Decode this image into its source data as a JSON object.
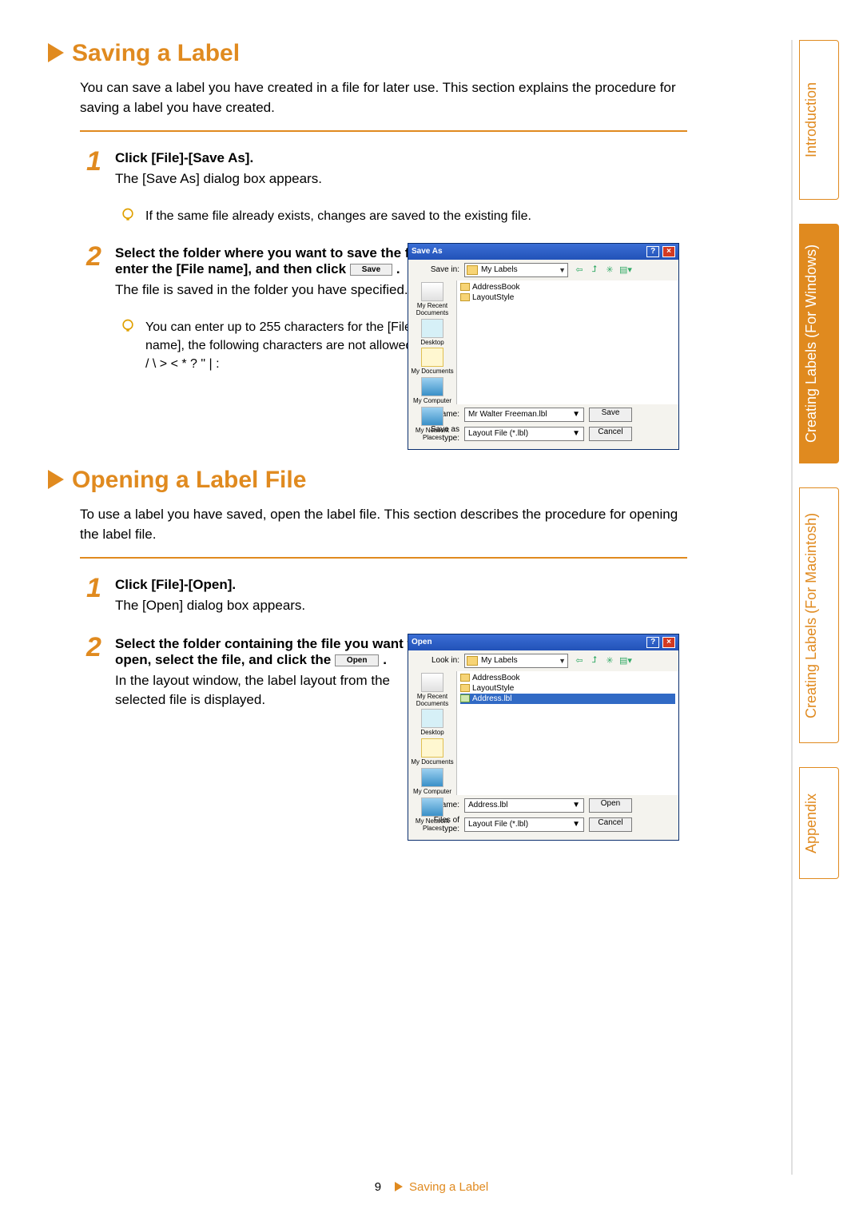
{
  "headings": {
    "saving": "Saving a Label",
    "opening": "Opening a Label File"
  },
  "intro": {
    "saving": "You can save a label you have created in a file for later use. This section explains the procedure for saving a label you have created.",
    "opening": "To use a label you have saved, open the label file. This section describes the procedure for opening the label file."
  },
  "steps_saving": {
    "s1_bold": "Click [File]-[Save As].",
    "s1_plain": "The [Save As] dialog box appears.",
    "s1_tip": "If the same file already exists, changes are saved to the existing file.",
    "s2_bold": "Select the folder where you want to save the file, enter the [File name], and then click ",
    "s2_btn": "Save",
    "s2_plain": "The file is saved in the folder you have specified.",
    "s2_tip_a": "You can enter up to 255 characters for the [File name], the following characters are not allowed:",
    "s2_tip_b": "/ \\ > < * ? \" | :"
  },
  "steps_opening": {
    "s1_bold": "Click [File]-[Open].",
    "s1_plain": "The [Open] dialog box appears.",
    "s2_bold": "Select the folder containing the file you want to open, select the file, and click the ",
    "s2_btn": "Open",
    "s2_plain": "In the layout window, the label layout from the selected file is displayed."
  },
  "dialogs": {
    "save": {
      "title": "Save As",
      "save_in_label": "Save in:",
      "folder": "My Labels",
      "items": [
        "AddressBook",
        "LayoutStyle"
      ],
      "file_name_label": "File name:",
      "file_name_value": "Mr Walter Freeman.lbl",
      "type_label": "Save as type:",
      "type_value": "Layout File (*.lbl)",
      "btn_primary": "Save",
      "btn_cancel": "Cancel"
    },
    "open": {
      "title": "Open",
      "look_in_label": "Look in:",
      "folder": "My Labels",
      "items": [
        "AddressBook",
        "LayoutStyle",
        "Address.lbl"
      ],
      "file_name_label": "File name:",
      "file_name_value": "Address.lbl",
      "type_label": "Files of type:",
      "type_value": "Layout File (*.lbl)",
      "btn_primary": "Open",
      "btn_cancel": "Cancel"
    },
    "places": {
      "recent": "My Recent Documents",
      "desktop": "Desktop",
      "docs": "My Documents",
      "computer": "My Computer",
      "network": "My Network Places"
    }
  },
  "sidebar": {
    "intro": "Introduction",
    "win": "Creating Labels (For Windows)",
    "mac": "Creating Labels (For Macintosh)",
    "appendix": "Appendix"
  },
  "footer": {
    "page": "9",
    "crumb": "Saving a Label"
  }
}
